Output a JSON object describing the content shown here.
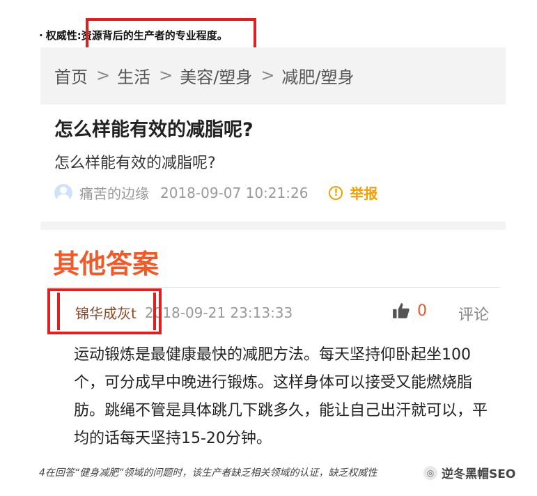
{
  "top_note": {
    "bullet": "·",
    "label": "权威性:",
    "text": "资源背后的生产者的专业程度。"
  },
  "breadcrumb": {
    "items": [
      "首页",
      "生活",
      "美容/塑身",
      "减肥/塑身"
    ],
    "separator": ">"
  },
  "question": {
    "title": "怎么样能有效的减脂呢?",
    "subtitle": "怎么样能有效的减脂呢?",
    "user": "痛苦的边缘",
    "time": "2018-09-07 10:21:26",
    "report_label": "举报",
    "report_icon": "warning-circle-icon"
  },
  "answers": {
    "heading": "其他答案",
    "first": {
      "author": "锦华成灰t",
      "time": "2018-09-21 23:13:33",
      "like_count": "0",
      "comment_label": "评论",
      "body": "运动锻炼是最健康最快的减肥方法。每天坚持仰卧起坐100个，可分成早中晚进行锻炼。这样身体可以接受又能燃烧脂肪。跳绳不管是具体跳几下跳多久，能让自己出汗就可以，平均的话每天坚持15-20分钟。"
    }
  },
  "caption": "4在回答“健身减肥”领域的问题时，该生产者缺乏相关领域的认证，缺乏权威性",
  "watermark": "逆冬黑帽SEO",
  "colors": {
    "highlight_box": "#e02020",
    "accent_orange": "#ef5a2a",
    "report_yellow": "#f2a000"
  }
}
